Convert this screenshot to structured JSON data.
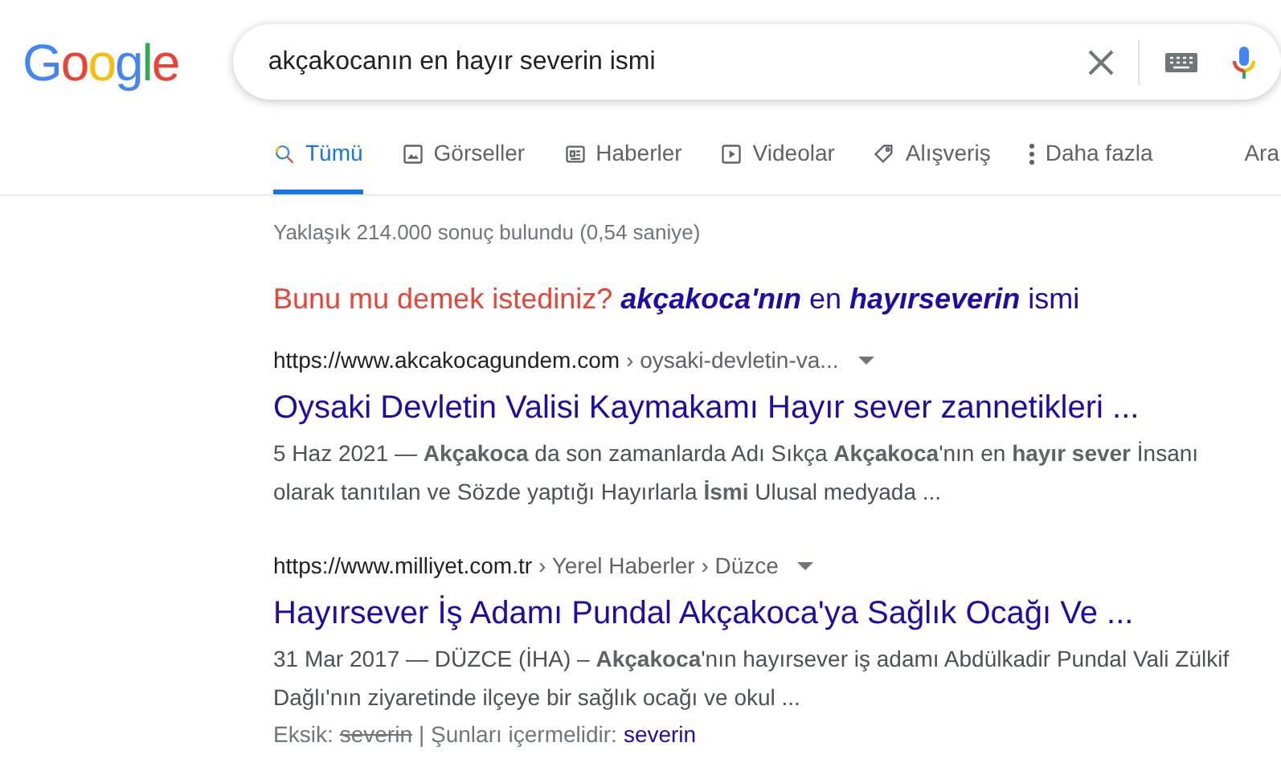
{
  "logo": "Google",
  "search": {
    "value": "akçakocanın en hayır severin ismi"
  },
  "tabs": [
    {
      "label": "Tümü",
      "kind": "all",
      "selected": true
    },
    {
      "label": "Görseller",
      "kind": "images",
      "selected": false
    },
    {
      "label": "Haberler",
      "kind": "news",
      "selected": false
    },
    {
      "label": "Videolar",
      "kind": "videos",
      "selected": false
    },
    {
      "label": "Alışveriş",
      "kind": "shopping",
      "selected": false
    },
    {
      "label": "Daha fazla",
      "kind": "more",
      "selected": false
    },
    {
      "label": "Ara",
      "kind": "tools",
      "selected": false
    }
  ],
  "result_stats": "Yaklaşık 214.000 sonuç bulundu (0,54 saniye)",
  "did_you_mean": {
    "prompt": "Bunu mu demek istediniz?",
    "suggestion": "**akçakoca'nın** en **hayırseverin** ismi"
  },
  "results": [
    {
      "url": "https://www.akcakocagundem.com",
      "path": "› oysaki-devletin-va...",
      "title": "Oysaki Devletin Valisi Kaymakamı Hayır sever zannetikleri ...",
      "snippet": "5 Haz 2021 — **Akçakoca** da son zamanlarda Adı Sıkça **Akçakoca**'nın en **hayır sever** İnsanı olarak tanıtılan ve Sözde yaptığı Hayırlarla **İsmi** Ulusal medyada ..."
    },
    {
      "url": "https://www.milliyet.com.tr",
      "path": "› Yerel Haberler › Düzce",
      "title": "Hayırsever İş Adamı Pundal Akçakoca'ya Sağlık Ocağı Ve ...",
      "snippet": "31 Mar 2017 — DÜZCE (İHA) – **Akçakoca**'nın hayırsever iş adamı Abdülkadir Pundal Vali Zülkif Dağlı'nın ziyaretinde ilçeye bir sağlık ocağı ve okul ...",
      "missing": {
        "label": "Eksik:",
        "word": "severin",
        "must_label": "| Şunları içermelidir:",
        "must_word": "severin"
      }
    }
  ]
}
